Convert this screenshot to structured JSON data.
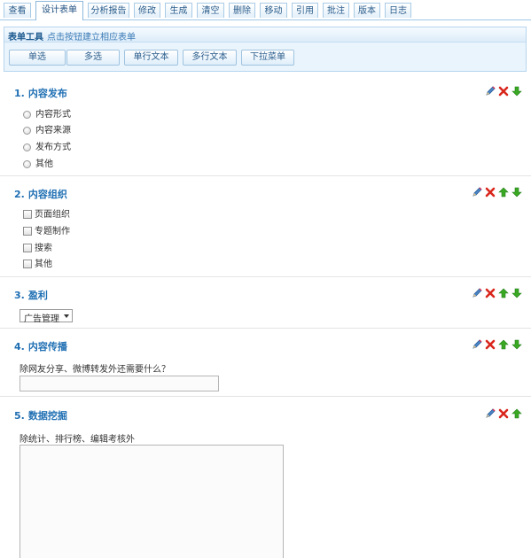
{
  "tabs": [
    "查看",
    "设计表单",
    "分析报告",
    "修改",
    "生成",
    "清空",
    "删除",
    "移动",
    "引用",
    "批注",
    "版本",
    "日志"
  ],
  "active_tab": "设计表单",
  "toolbox": {
    "title": "表单工具",
    "hint": "点击按钮建立相应表单",
    "buttons": [
      "单选",
      "多选",
      "单行文本",
      "多行文本",
      "下拉菜单"
    ]
  },
  "questions": [
    {
      "num": "1.",
      "title": "内容发布",
      "type": "radio",
      "options": [
        "内容形式",
        "内容来源",
        "发布方式",
        "其他"
      ],
      "actions": [
        "edit-icon",
        "delete-icon",
        "move-down-icon"
      ]
    },
    {
      "num": "2.",
      "title": "内容组织",
      "type": "checkbox",
      "options": [
        "页面组织",
        "专题制作",
        "搜索",
        "其他"
      ],
      "actions": [
        "edit-icon",
        "delete-icon",
        "move-up-icon",
        "move-down-icon"
      ]
    },
    {
      "num": "3.",
      "title": "盈利",
      "type": "select",
      "selected": "广告管理",
      "actions": [
        "edit-icon",
        "delete-icon",
        "move-up-icon",
        "move-down-icon"
      ]
    },
    {
      "num": "4.",
      "title": "内容传播",
      "type": "text",
      "prompt": "除网友分享、微博转发外还需要什么？",
      "value": "",
      "actions": [
        "edit-icon",
        "delete-icon",
        "move-up-icon",
        "move-down-icon"
      ]
    },
    {
      "num": "5.",
      "title": "数据挖掘",
      "type": "textarea",
      "prompt": "除统计、排行榜、编辑考核外",
      "value": "",
      "actions": [
        "edit-icon",
        "delete-icon",
        "move-up-icon"
      ]
    }
  ],
  "colors": {
    "accent": "#1f6fb3",
    "delete": "#d9261c",
    "arrow": "#3aa823",
    "edit": "#3b6fb6"
  }
}
